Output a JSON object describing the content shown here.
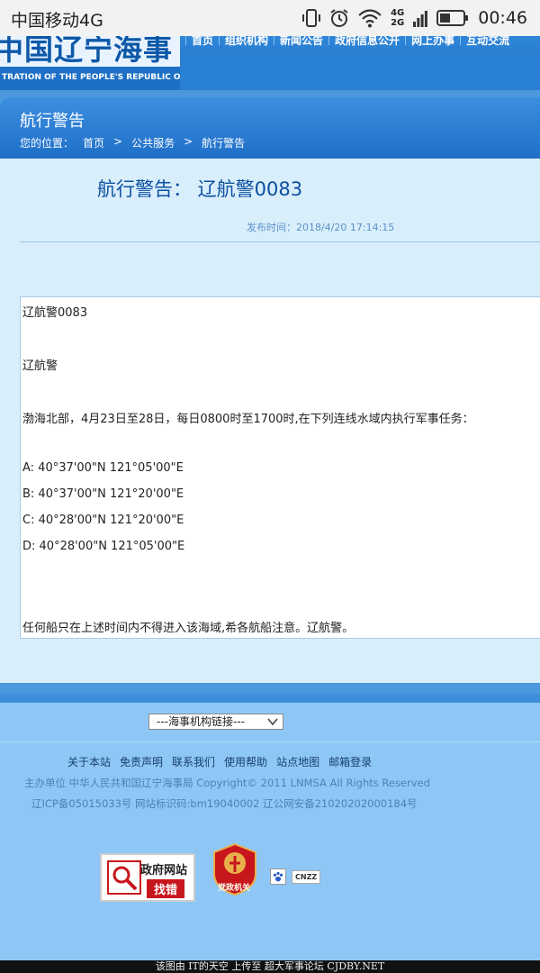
{
  "status_bar": {
    "carrier": "中国移动4G",
    "network_top": "4G",
    "network_bottom": "2G",
    "time": "00:46"
  },
  "header": {
    "logo_cn": "中国辽宁海事局",
    "logo_en": "TRATION OF THE PEOPLE'S REPUBLIC OF CHINA",
    "nav": [
      "首页",
      "组织机构",
      "新闻公告",
      "政府信息公开",
      "网上办事",
      "互动交流"
    ]
  },
  "panel": {
    "title": "航行警告",
    "breadcrumb": {
      "label": "您的位置：",
      "home": "首页",
      "sep1": ">",
      "section": "公共服务",
      "sep2": ">",
      "current": "航行警告"
    },
    "article_title": "航行警告： 辽航警0083",
    "pubtime": "发布时间：2018/4/20 17:14:15",
    "content": {
      "line1": "辽航警0083",
      "line2": "辽航警",
      "line3": "渤海北部，4月23日至28日，每日0800时至1700时,在下列连线水域内执行军事任务：",
      "point_a": "A: 40°37'00\"N 121°05'00\"E",
      "point_b": "B: 40°37'00\"N 121°20'00\"E",
      "point_c": "C: 40°28'00\"N 121°20'00\"E",
      "point_d": "D: 40°28'00\"N 121°05'00\"E",
      "line_last": "任何船只在上述时间内不得进入该海域,希各航船注意。辽航警。"
    }
  },
  "footer": {
    "select_value": "---海事机构链接---",
    "links": [
      "关于本站",
      "免责声明",
      "联系我们",
      "使用帮助",
      "站点地图",
      "邮箱登录"
    ],
    "info1": "主办单位 中华人民共和国辽宁海事局 Copyright© 2011 LNMSA All Rights Reserved",
    "info2": "辽ICP备05015033号  网站标识码:bm19040002  辽公网安备21020202000184号",
    "badge_gov_top": "政府网站",
    "badge_gov_bottom": "找错",
    "badge_party": "党政机关",
    "cnzz": "CNZZ",
    "watermark": "该图由 IT的天空 上传至 超大军事论坛 CJDBY.NET"
  }
}
